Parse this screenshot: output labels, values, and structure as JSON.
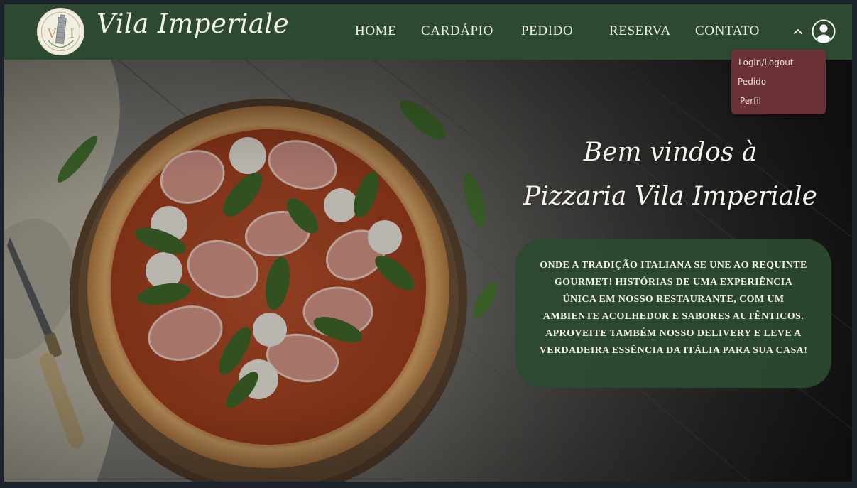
{
  "brand": {
    "monogram": "VI",
    "name": "Vila Imperiale"
  },
  "nav": {
    "links": [
      "HOME",
      "CARDÁPIO",
      "PEDIDO",
      "RESERVA",
      "CONTATO"
    ]
  },
  "dropdown": {
    "items": [
      "Login/Logout",
      "Pedido",
      "Perfil"
    ]
  },
  "hero": {
    "title_line1": "Bem vindos à",
    "title_line2": "Pizzaria Vila Imperiale",
    "description": "Onde a tradição italiana se une ao requinte gourmet! Histórias de uma experiência única em nosso restaurante, com um ambiente acolhedor e sabores autênticos. Aproveite também nosso delivery e leve a verdadeira essência da Itália para sua casa!",
    "image": "pizza-on-wooden-board"
  },
  "icons": {
    "caret": "chevron-up-icon",
    "user": "user-circle-icon",
    "logo": "leaning-tower-icon"
  },
  "colors": {
    "navbar": "#2d4a30",
    "dropdown": "#6b3236",
    "info_box": "#2d4a30",
    "text_light": "#f4f1e8"
  }
}
